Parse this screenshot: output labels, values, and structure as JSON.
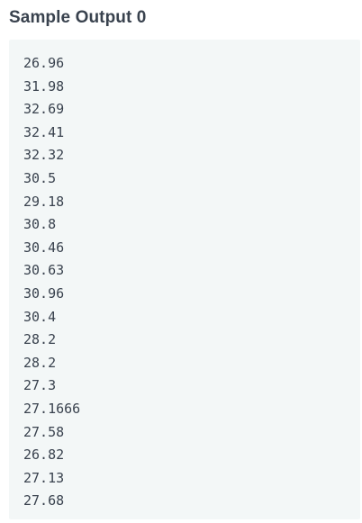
{
  "section": {
    "title": "Sample Output 0"
  },
  "output": {
    "lines": [
      "26.96",
      "31.98",
      "32.69",
      "32.41",
      "32.32",
      "30.5",
      "29.18",
      "30.8",
      "30.46",
      "30.63",
      "30.96",
      "30.4",
      "28.2",
      "28.2",
      "27.3",
      "27.1666",
      "27.58",
      "26.82",
      "27.13",
      "27.68"
    ]
  }
}
